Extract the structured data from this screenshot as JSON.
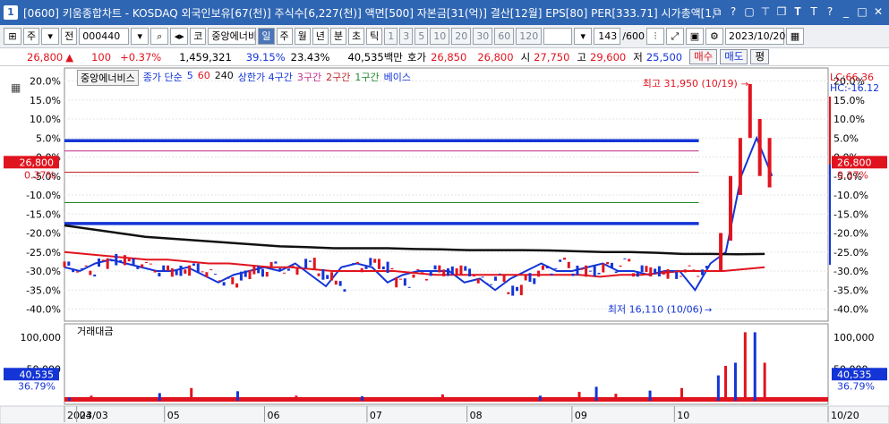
{
  "window": {
    "number": "1",
    "title": "[0600] 키움종합차트 - KOSDAQ 외국인보유[67(천)] 주식수[6,227(천)] 액면[500] 자본금[31(억)] 결산[12월] EPS[80] PER[333.71] 시가총액[1,",
    "icons": [
      "restore-icon",
      "help-icon",
      "lock-icon",
      "pin-icon",
      "copy-icon",
      "text-icon",
      "font-icon",
      "settings-icon",
      "minimize-icon",
      "maximize-icon",
      "close-icon"
    ]
  },
  "toolbar": {
    "market": "주",
    "prev": "전",
    "code": "000440",
    "market_tag": "코",
    "name": "중앙에너비",
    "periods": [
      "일",
      "주",
      "월",
      "년",
      "분",
      "초",
      "틱"
    ],
    "active_period": "일",
    "intervals": [
      "1",
      "3",
      "5",
      "10",
      "20",
      "30",
      "60",
      "120"
    ],
    "count": "143",
    "total": "/600",
    "date": "2023/10/20"
  },
  "quote": {
    "price": "26,800",
    "change": "100",
    "change_pct": "+0.37%",
    "volume": "1,459,321",
    "ratio1": "39.15%",
    "ratio2": "23.43%",
    "amount": "40,535백만",
    "hoga_label": "호가",
    "ask": "26,850",
    "bid": "26,800",
    "open_label": "시",
    "open": "27,750",
    "high_label": "고",
    "high": "29,600",
    "low_label": "저",
    "low": "25,500",
    "buy": "매수",
    "sell": "매도",
    "avg": "평"
  },
  "legend": {
    "name": "중앙에너비스",
    "ma_label": "종가 단순",
    "ma5": "5",
    "ma60": "60",
    "ma240": "240",
    "upper": "상한가 4구간",
    "z3": "3구간",
    "z2": "2구간",
    "z1": "1구간",
    "base": "베이스"
  },
  "volume_legend": "거래대금",
  "right_labels": {
    "lc": "LC:66.36",
    "hc": "HC:-16.12"
  },
  "annotations": {
    "high": "최고 31,950 (10/19)",
    "low": "최저 16,110 (10/06)"
  },
  "price_tag": {
    "price": "26,800",
    "pct": "0.37%"
  },
  "volume_tag": {
    "value": "40,535",
    "pct": "36.79%"
  },
  "chart_data": {
    "type": "line",
    "title": "",
    "xlabel": "",
    "ylabel": "",
    "y_axis_ticks": [
      "20.0%",
      "15.0%",
      "10.0%",
      "5.0%",
      "0.0%",
      "-5.0%",
      "-10.0%",
      "-15.0%",
      "-20.0%",
      "-25.0%",
      "-30.0%",
      "-35.0%",
      "-40.0%"
    ],
    "y_values": [
      20,
      15,
      10,
      5,
      0,
      -5,
      -10,
      -15,
      -20,
      -25,
      -30,
      -35,
      -40
    ],
    "ylim": [
      -42,
      22
    ],
    "x_axis_labels": [
      "2023/03",
      "04",
      "05",
      "06",
      "07",
      "08",
      "09",
      "10",
      "10/20"
    ],
    "x_months": [
      0,
      0.5,
      4.1,
      8.2,
      12.4,
      16.5,
      20.8,
      25.0,
      31.3
    ],
    "volume_ticks": [
      "100,000",
      "50,000"
    ],
    "volume_values": [
      100000,
      50000
    ],
    "vol_max": 110000,
    "series": [
      {
        "name": "5",
        "color": "#1435d6",
        "values": [
          -29,
          -30,
          -28,
          -27,
          -28,
          -29,
          -30,
          -30,
          -29,
          -31,
          -33,
          -31,
          -30,
          -29,
          -30,
          -28,
          -31,
          -34,
          -29,
          -28,
          -29,
          -33,
          -31,
          -30,
          -30,
          -30,
          -33,
          -32,
          -35,
          -32,
          -30,
          -28,
          -30,
          -30,
          -29,
          -28,
          -30,
          -30,
          -31,
          -30,
          -30,
          -35,
          -28,
          -25,
          -5,
          5,
          -5
        ]
      },
      {
        "name": "60",
        "color": "#e0141e",
        "values": [
          -25,
          -25.5,
          -26,
          -26.5,
          -27,
          -27,
          -27.5,
          -28,
          -28,
          -28.5,
          -29,
          -29,
          -29.5,
          -30,
          -30,
          -30,
          -30,
          -30.5,
          -31,
          -31,
          -31,
          -31,
          -31,
          -31,
          -31,
          -31,
          -31.5,
          -31,
          -31,
          -30.5,
          -30,
          -30,
          -30,
          -29.5,
          -29
        ]
      },
      {
        "name": "240",
        "color": "#111111",
        "values": [
          -18,
          -19,
          -20,
          -21,
          -21.5,
          -22,
          -22.5,
          -23,
          -23.5,
          -23.7,
          -24,
          -24,
          -24,
          -24.2,
          -24.3,
          -24.5,
          -24.5,
          -24.5,
          -24.6,
          -24.8,
          -25,
          -25,
          -25.2,
          -25.5,
          -25.5,
          -25.6,
          -25.5
        ]
      }
    ],
    "zones": {
      "upper": {
        "name": "상한가 4구간",
        "value": 4.3
      },
      "z3": {
        "name": "3구간",
        "value": 1.6
      },
      "z2": {
        "name": "2구간",
        "value": -4.0
      },
      "z1": {
        "name": "1구간",
        "value": -12.0
      },
      "base": {
        "name": "베이스",
        "value": -17.5
      }
    },
    "high": {
      "label": "최고 31,950 (10/19)",
      "value": 19.2
    },
    "low": {
      "label": "최저 16,110 (10/06)",
      "value": -40.0
    },
    "volume_spikes": [
      {
        "x": 0.2,
        "v": 5000
      },
      {
        "x": 1.1,
        "v": 8000
      },
      {
        "x": 3.9,
        "v": 12000
      },
      {
        "x": 5.2,
        "v": 20000
      },
      {
        "x": 7.1,
        "v": 15000
      },
      {
        "x": 9.5,
        "v": 8000
      },
      {
        "x": 12.2,
        "v": 7000
      },
      {
        "x": 15.5,
        "v": 10000
      },
      {
        "x": 19.5,
        "v": 8000
      },
      {
        "x": 21.1,
        "v": 14000
      },
      {
        "x": 21.8,
        "v": 22000
      },
      {
        "x": 22.6,
        "v": 11000
      },
      {
        "x": 24.0,
        "v": 16000
      },
      {
        "x": 25.3,
        "v": 20000
      },
      {
        "x": 26.8,
        "v": 40000
      },
      {
        "x": 27.1,
        "v": 55000
      },
      {
        "x": 27.5,
        "v": 60000
      },
      {
        "x": 27.9,
        "v": 108000
      },
      {
        "x": 28.3,
        "v": 108000
      },
      {
        "x": 28.7,
        "v": 60000
      }
    ]
  },
  "colors": {
    "title_bg": "#2f66b3",
    "up": "#e0141e",
    "down": "#1435d6",
    "ma240": "#111111",
    "upper_zone": "#1435d6",
    "zone3": "#c02c8a",
    "zone2": "#c22424",
    "zone1": "#1d8a2b"
  }
}
